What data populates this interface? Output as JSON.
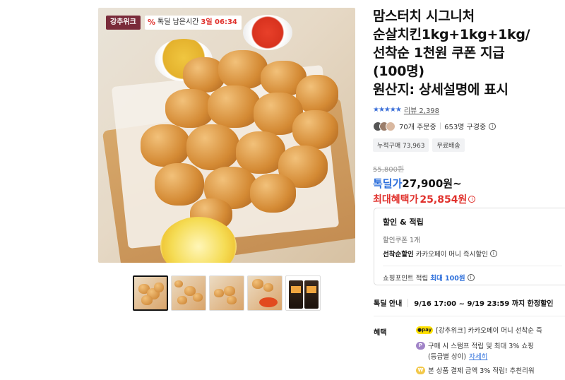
{
  "product": {
    "image_badge_brand": "강추위크",
    "image_badge_deal_percent": "%",
    "image_badge_deal_label": "톡딜 남은시간",
    "image_badge_remaining": "3일 06:34",
    "title": "맘스터치 시그니처\n순살치킨1kg+1kg+1kg/\n선착순 1천원 쿠폰 지급\n(100명)\n원산지: 상세설명에 표시",
    "rating_stars": "★★★★★",
    "review_label": "리뷰 2,398",
    "orders": "70개 주문중",
    "viewers": "653명 구경중",
    "chips": [
      "누적구매 73,963",
      "무료배송"
    ],
    "original_price": "55,800원",
    "deal_price_label": "톡딜가",
    "deal_price": "27,900원~",
    "best_price_label": "최대혜택가",
    "best_price": "25,854원"
  },
  "benefits": {
    "title": "할인 & 적립",
    "coupon": "할인쿠폰 1개",
    "first_come_label": "선착순할인",
    "first_come_text": "카카오페이 머니 즉시할인",
    "points_label": "쇼핑포인트 적립",
    "points_max": "최대 100원"
  },
  "deal_info": {
    "label": "톡딜 안내",
    "period": "9/16 17:00 ~ 9/19 23:59 까지 한정할인"
  },
  "perks": {
    "label": "혜택",
    "items": [
      {
        "badge": "●pay",
        "text": "[강추위크] 카카오페이 머니 선착순 즉"
      },
      {
        "badge": "P",
        "text": "구매 시 스탬프 적립 및 최대 3% 쇼핑"
      },
      {
        "badge": "",
        "text": "(등급별 상이)",
        "link": "자세히"
      },
      {
        "badge": "₩",
        "text": "본 상품 결제 금액 3% 적립! 추천리워"
      }
    ]
  },
  "icons": {
    "info": "i"
  }
}
